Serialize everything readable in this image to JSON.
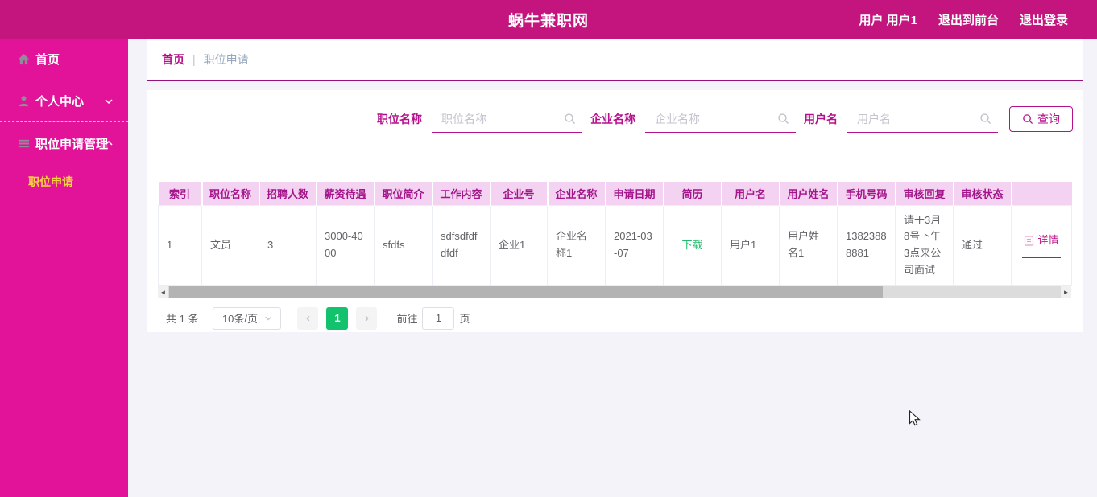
{
  "colors": {
    "header_bg": "#c4157f",
    "sidebar_bg": "#e21299",
    "accent_magenta": "#b5118c",
    "submenu_yellow": "#f5d33f",
    "dashed_divider_yellow": "#edc53f",
    "table_header_bg": "#f3d3f1",
    "table_header_text": "#a4148a",
    "pagination_active_green": "#13c26c",
    "download_link_green": "#1fbc6c",
    "body_text_gray": "#606266"
  },
  "header": {
    "title": "蜗牛兼职网",
    "user": "用户 用户1",
    "exit_to_front": "退出到前台",
    "logout": "退出登录"
  },
  "sidebar": {
    "home": "首页",
    "personal_center": "个人中心",
    "job_apply_mgmt": "职位申请管理",
    "job_apply": "职位申请"
  },
  "breadcrumb": {
    "home": "首页",
    "separator": "|",
    "current": "职位申请"
  },
  "filters": {
    "job_name_label": "职位名称",
    "job_name_placeholder": "职位名称",
    "company_label": "企业名称",
    "company_placeholder": "企业名称",
    "username_label": "用户名",
    "username_placeholder": "用户名",
    "query_button": "查询"
  },
  "table": {
    "headers": [
      "索引",
      "职位名称",
      "招聘人数",
      "薪资待遇",
      "职位简介",
      "工作内容",
      "企业号",
      "企业名称",
      "申请日期",
      "简历",
      "用户名",
      "用户姓名",
      "手机号码",
      "审核回复",
      "审核状态",
      ""
    ],
    "row": {
      "index": "1",
      "job_name": "文员",
      "recruit_count": "3",
      "salary": "3000-4000",
      "job_intro": "sfdfs",
      "work_content": "sdfsdfdfdfdf",
      "company_no": "企业1",
      "company_name": "企业名称1",
      "apply_date": "2021-03-07",
      "resume": "下载",
      "username": "用户1",
      "user_fullname": "用户姓名1",
      "phone": "13823888881",
      "review_reply": "请于3月8号下午3点来公司面试",
      "review_status": "通过",
      "detail": "详情"
    }
  },
  "pagination": {
    "total": "共 1 条",
    "page_size": "10条/页",
    "prev": "‹",
    "current_page": "1",
    "next": "›",
    "goto_label": "前往",
    "goto_value": "1",
    "goto_unit": "页"
  }
}
